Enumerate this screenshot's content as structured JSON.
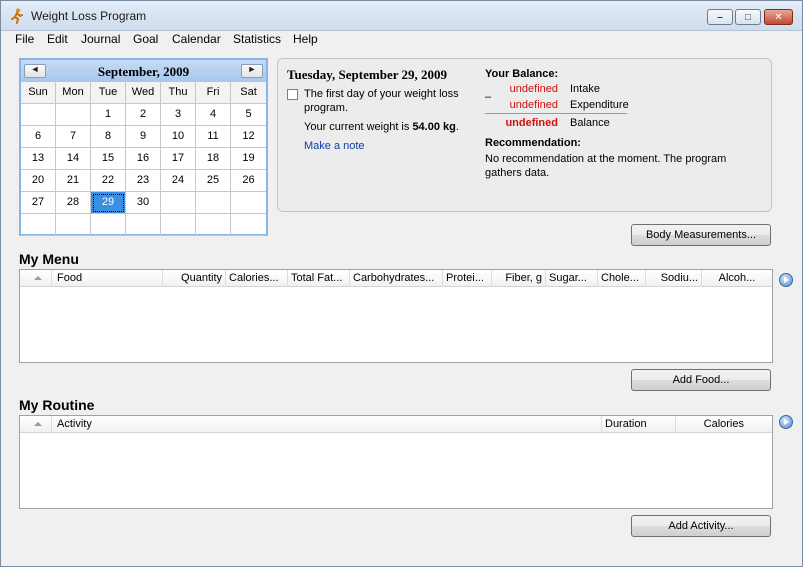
{
  "window": {
    "title": "Weight Loss Program",
    "controls": {
      "minimize": "–",
      "maximize": "□",
      "close": "✕"
    }
  },
  "menu": [
    "File",
    "Edit",
    "Journal",
    "Goal",
    "Calendar",
    "Statistics",
    "Help"
  ],
  "calendar": {
    "title": "September, 2009",
    "prev": "◄",
    "next": "►",
    "day_names": [
      "Sun",
      "Mon",
      "Tue",
      "Wed",
      "Thu",
      "Fri",
      "Sat"
    ],
    "weeks": [
      [
        "",
        "",
        "1",
        "2",
        "3",
        "4",
        "5"
      ],
      [
        "6",
        "7",
        "8",
        "9",
        "10",
        "11",
        "12"
      ],
      [
        "13",
        "14",
        "15",
        "16",
        "17",
        "18",
        "19"
      ],
      [
        "20",
        "21",
        "22",
        "23",
        "24",
        "25",
        "26"
      ],
      [
        "27",
        "28",
        "29",
        "30",
        "",
        "",
        ""
      ],
      [
        "",
        "",
        "",
        "",
        "",
        "",
        ""
      ]
    ],
    "selected_day": "29",
    "selected_color": "#3b8fe0"
  },
  "info": {
    "date_title": "Tuesday, September 29, 2009",
    "first_day_text": "The first day of your weight loss program.",
    "weight_prefix": "Your current weight is",
    "weight_value": "54.00 kg",
    "weight_suffix": ".",
    "make_note": "Make a note"
  },
  "balance": {
    "title": "Your Balance:",
    "dash": "–",
    "rows": [
      {
        "value": "undefined",
        "label": "Intake"
      },
      {
        "value": "undefined",
        "label": "Expenditure"
      },
      {
        "value": "undefined",
        "label": "Balance"
      }
    ],
    "value_color": "#d01010",
    "recommendation_title": "Recommendation:",
    "recommendation_text": "No recommendation at the moment. The program gathers data."
  },
  "buttons": {
    "body_measurements": "Body Measurements...",
    "add_food": "Add Food...",
    "add_activity": "Add Activity..."
  },
  "menu_section": {
    "title": "My Menu",
    "columns": [
      "Food",
      "Quantity",
      "Calories...",
      "Total Fat...",
      "Carbohydrates...",
      "Protei...",
      "Fiber, g",
      "Sugar...",
      "Chole...",
      "Sodiu...",
      "Alcoh..."
    ],
    "rows": []
  },
  "routine_section": {
    "title": "My Routine",
    "columns": [
      "Activity",
      "Duration",
      "Calories"
    ],
    "rows": []
  },
  "icons": {
    "app": "runner-icon",
    "scroll": "scroll-right-icon",
    "sort": "sort-ascending-icon"
  }
}
